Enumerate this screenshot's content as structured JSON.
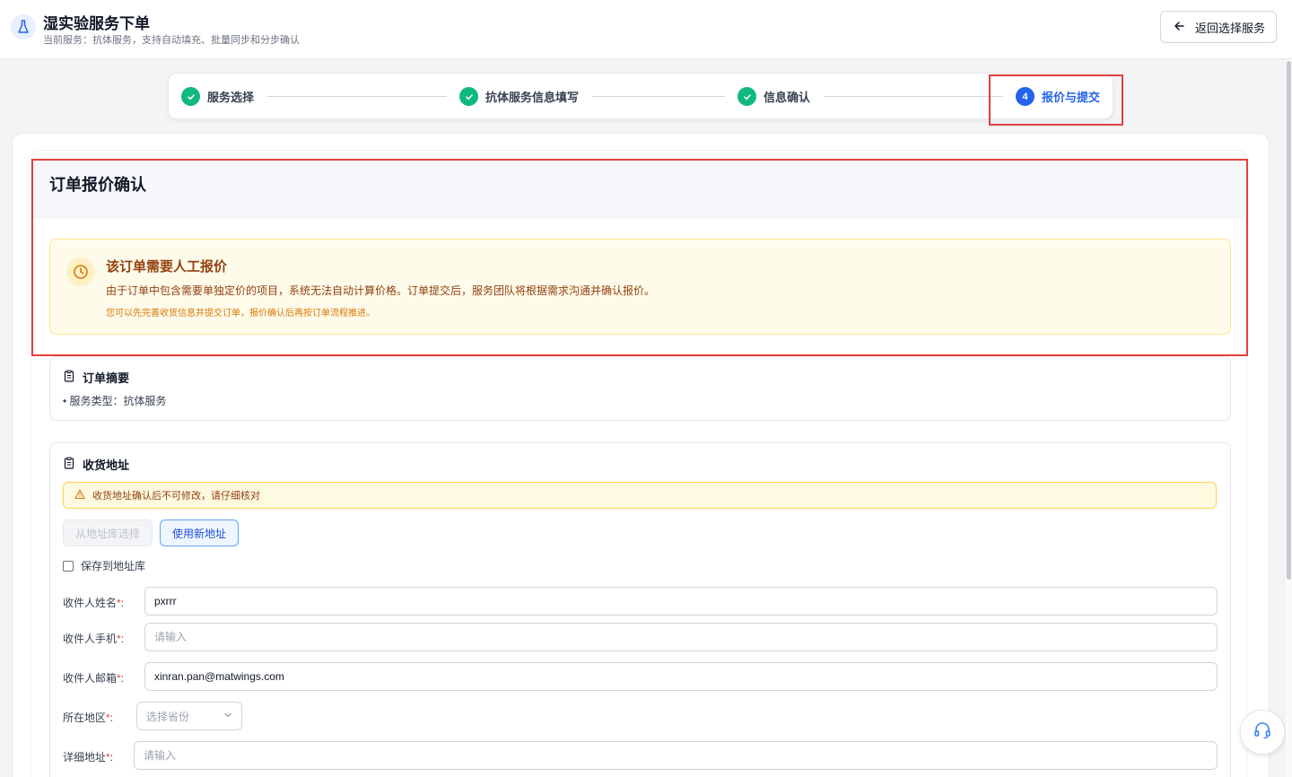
{
  "header": {
    "title": "湿实验服务下单",
    "subtitle": "当前服务：抗体服务，支持自动填充、批量同步和分步确认",
    "back_label": "返回选择服务"
  },
  "steps": [
    {
      "label": "服务选择",
      "status": "done"
    },
    {
      "label": "抗体服务信息填写",
      "status": "done"
    },
    {
      "label": "信息确认",
      "status": "done"
    },
    {
      "number": "4",
      "label": "报价与提交",
      "status": "active"
    }
  ],
  "order": {
    "title": "订单报价确认",
    "notice_title": "该订单需要人工报价",
    "notice_body": "由于订单中包含需要单独定价的项目，系统无法自动计算价格。订单提交后，服务团队将根据需求沟通并确认报价。",
    "notice_hint": "您可以先完善收货信息并提交订单，报价确认后再按订单流程推进。"
  },
  "summary": {
    "title": "订单摘要",
    "line": "• 服务类型：抗体服务"
  },
  "address": {
    "title": "收货地址",
    "warning": "收货地址确认后不可修改，请仔细核对",
    "from_library_label": "从地址库选择",
    "use_new_label": "使用新地址",
    "save_label": "保存到地址库",
    "fields": {
      "name_label": "收件人姓名",
      "name_value": "pxrrr",
      "phone_label": "收件人手机",
      "phone_placeholder": "请输入",
      "email_label": "收件人邮箱",
      "email_value": "xinran.pan@matwings.com",
      "region_label": "所在地区",
      "region_placeholder": "选择省份",
      "detail_label": "详细地址",
      "detail_placeholder": "请输入"
    },
    "required_mark": "*",
    "colon": ":"
  },
  "colors": {
    "primary": "#2563eb",
    "success": "#10b981",
    "warning_bg": "#fffbeb",
    "warning_text": "#92400e",
    "highlight": "#e53e3e"
  }
}
